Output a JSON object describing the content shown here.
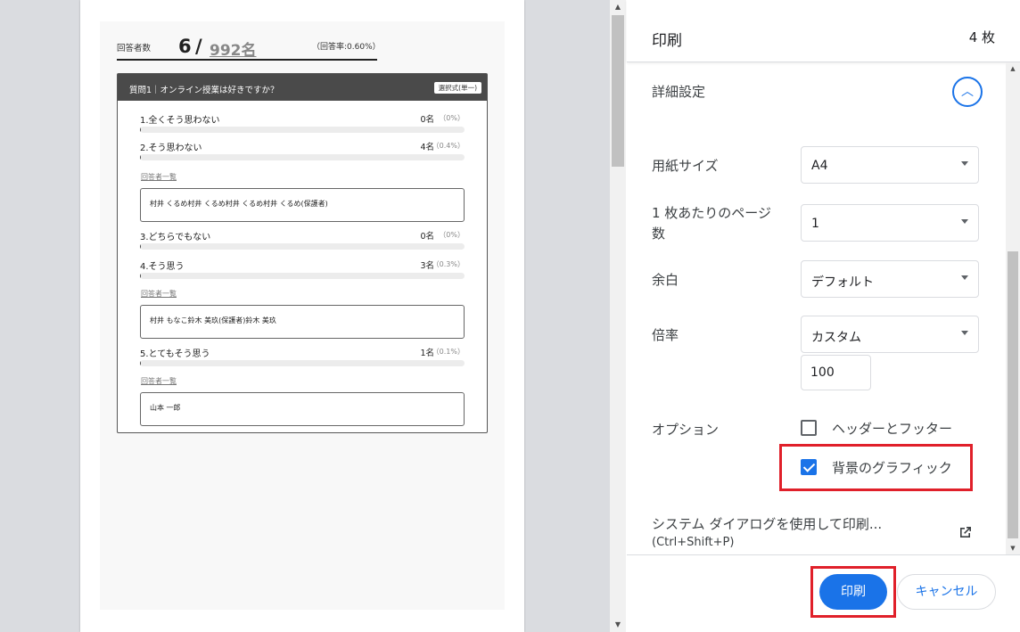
{
  "preview": {
    "summary": {
      "label": "回答者数",
      "count": "6",
      "slash": "/",
      "total": "992名",
      "rate": "（回答率:0.60%）"
    },
    "question": {
      "title": "質問1｜オンライン授業は好きですか？",
      "type": "選択式(単一)",
      "options": [
        {
          "label": "1.全くそう思わない",
          "count": "0名",
          "pct": "（0%）",
          "fraction": 0.0
        },
        {
          "label": "2.そう思わない",
          "count": "4名",
          "pct": "（0.4%）",
          "fraction": 0.004
        },
        {
          "label": "3.どちらでもない",
          "count": "0名",
          "pct": "（0%）",
          "fraction": 0.0
        },
        {
          "label": "4.そう思う",
          "count": "3名",
          "pct": "（0.3%）",
          "fraction": 0.003
        },
        {
          "label": "5.とてもそう思う",
          "count": "1名",
          "pct": "（0.1%）",
          "fraction": 0.001
        }
      ],
      "responder_link": "回答者一覧",
      "responders": [
        "村井 くるめ村井 くるめ村井 くるめ村井 くるめ(保護者)",
        "村井 もなこ鈴木 美玖(保護者)鈴木 美玖",
        "山本 一郎"
      ]
    }
  },
  "scrollbar": {
    "up": "▲",
    "down": "▼"
  },
  "panel": {
    "title": "印刷",
    "sheets": "4 枚",
    "advanced_label": "詳細設定",
    "expand_icon": "︿",
    "settings": {
      "paper_size": {
        "label": "用紙サイズ",
        "value": "A4"
      },
      "pages_per_sheet": {
        "label_line1": "1 枚あたりのページ",
        "label_line2": "数",
        "value": "1"
      },
      "margins": {
        "label": "余白",
        "value": "デフォルト"
      },
      "scale": {
        "label": "倍率",
        "value": "カスタム",
        "custom_value": "100"
      }
    },
    "options": {
      "label": "オプション",
      "headers_footers": {
        "label": "ヘッダーとフッター",
        "checked": false
      },
      "background_graphics": {
        "label": "背景のグラフィック",
        "checked": true
      }
    },
    "system_dialog": {
      "label": "システム ダイアログを使用して印刷...",
      "shortcut": "(Ctrl+Shift+P)"
    },
    "buttons": {
      "print": "印刷",
      "cancel": "キャンセル"
    },
    "accent_color": "#1a73e8",
    "highlight_color": "#e0202a"
  }
}
